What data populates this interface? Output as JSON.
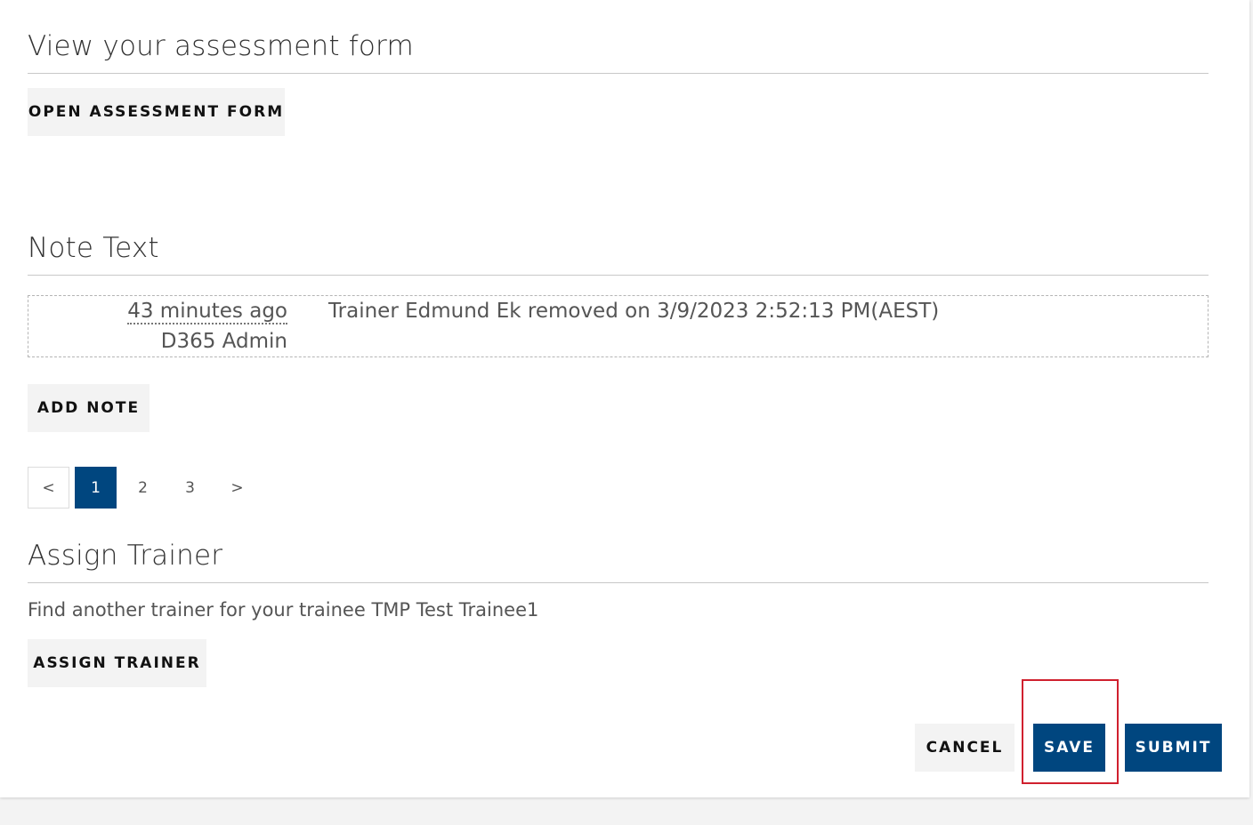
{
  "assessment": {
    "title": "View your assessment form",
    "open_button": "OPEN ASSESSMENT FORM"
  },
  "notes": {
    "title": "Note Text",
    "entries": [
      {
        "time": "43 minutes ago",
        "author": "D365 Admin",
        "text": "Trainer Edmund Ek removed on 3/9/2023 2:52:13 PM(AEST)"
      }
    ],
    "add_button": "ADD NOTE"
  },
  "pagination": {
    "prev": "<",
    "pages": [
      "1",
      "2",
      "3"
    ],
    "active_page": "1",
    "next": ">"
  },
  "assign": {
    "title": "Assign Trainer",
    "description": "Find another trainer for your trainee TMP Test Trainee1",
    "button": "ASSIGN TRAINER"
  },
  "actions": {
    "cancel": "CANCEL",
    "save": "SAVE",
    "submit": "SUBMIT"
  },
  "colors": {
    "primary": "#00467f",
    "highlight": "#d0202e",
    "light_button": "#f3f3f3"
  }
}
